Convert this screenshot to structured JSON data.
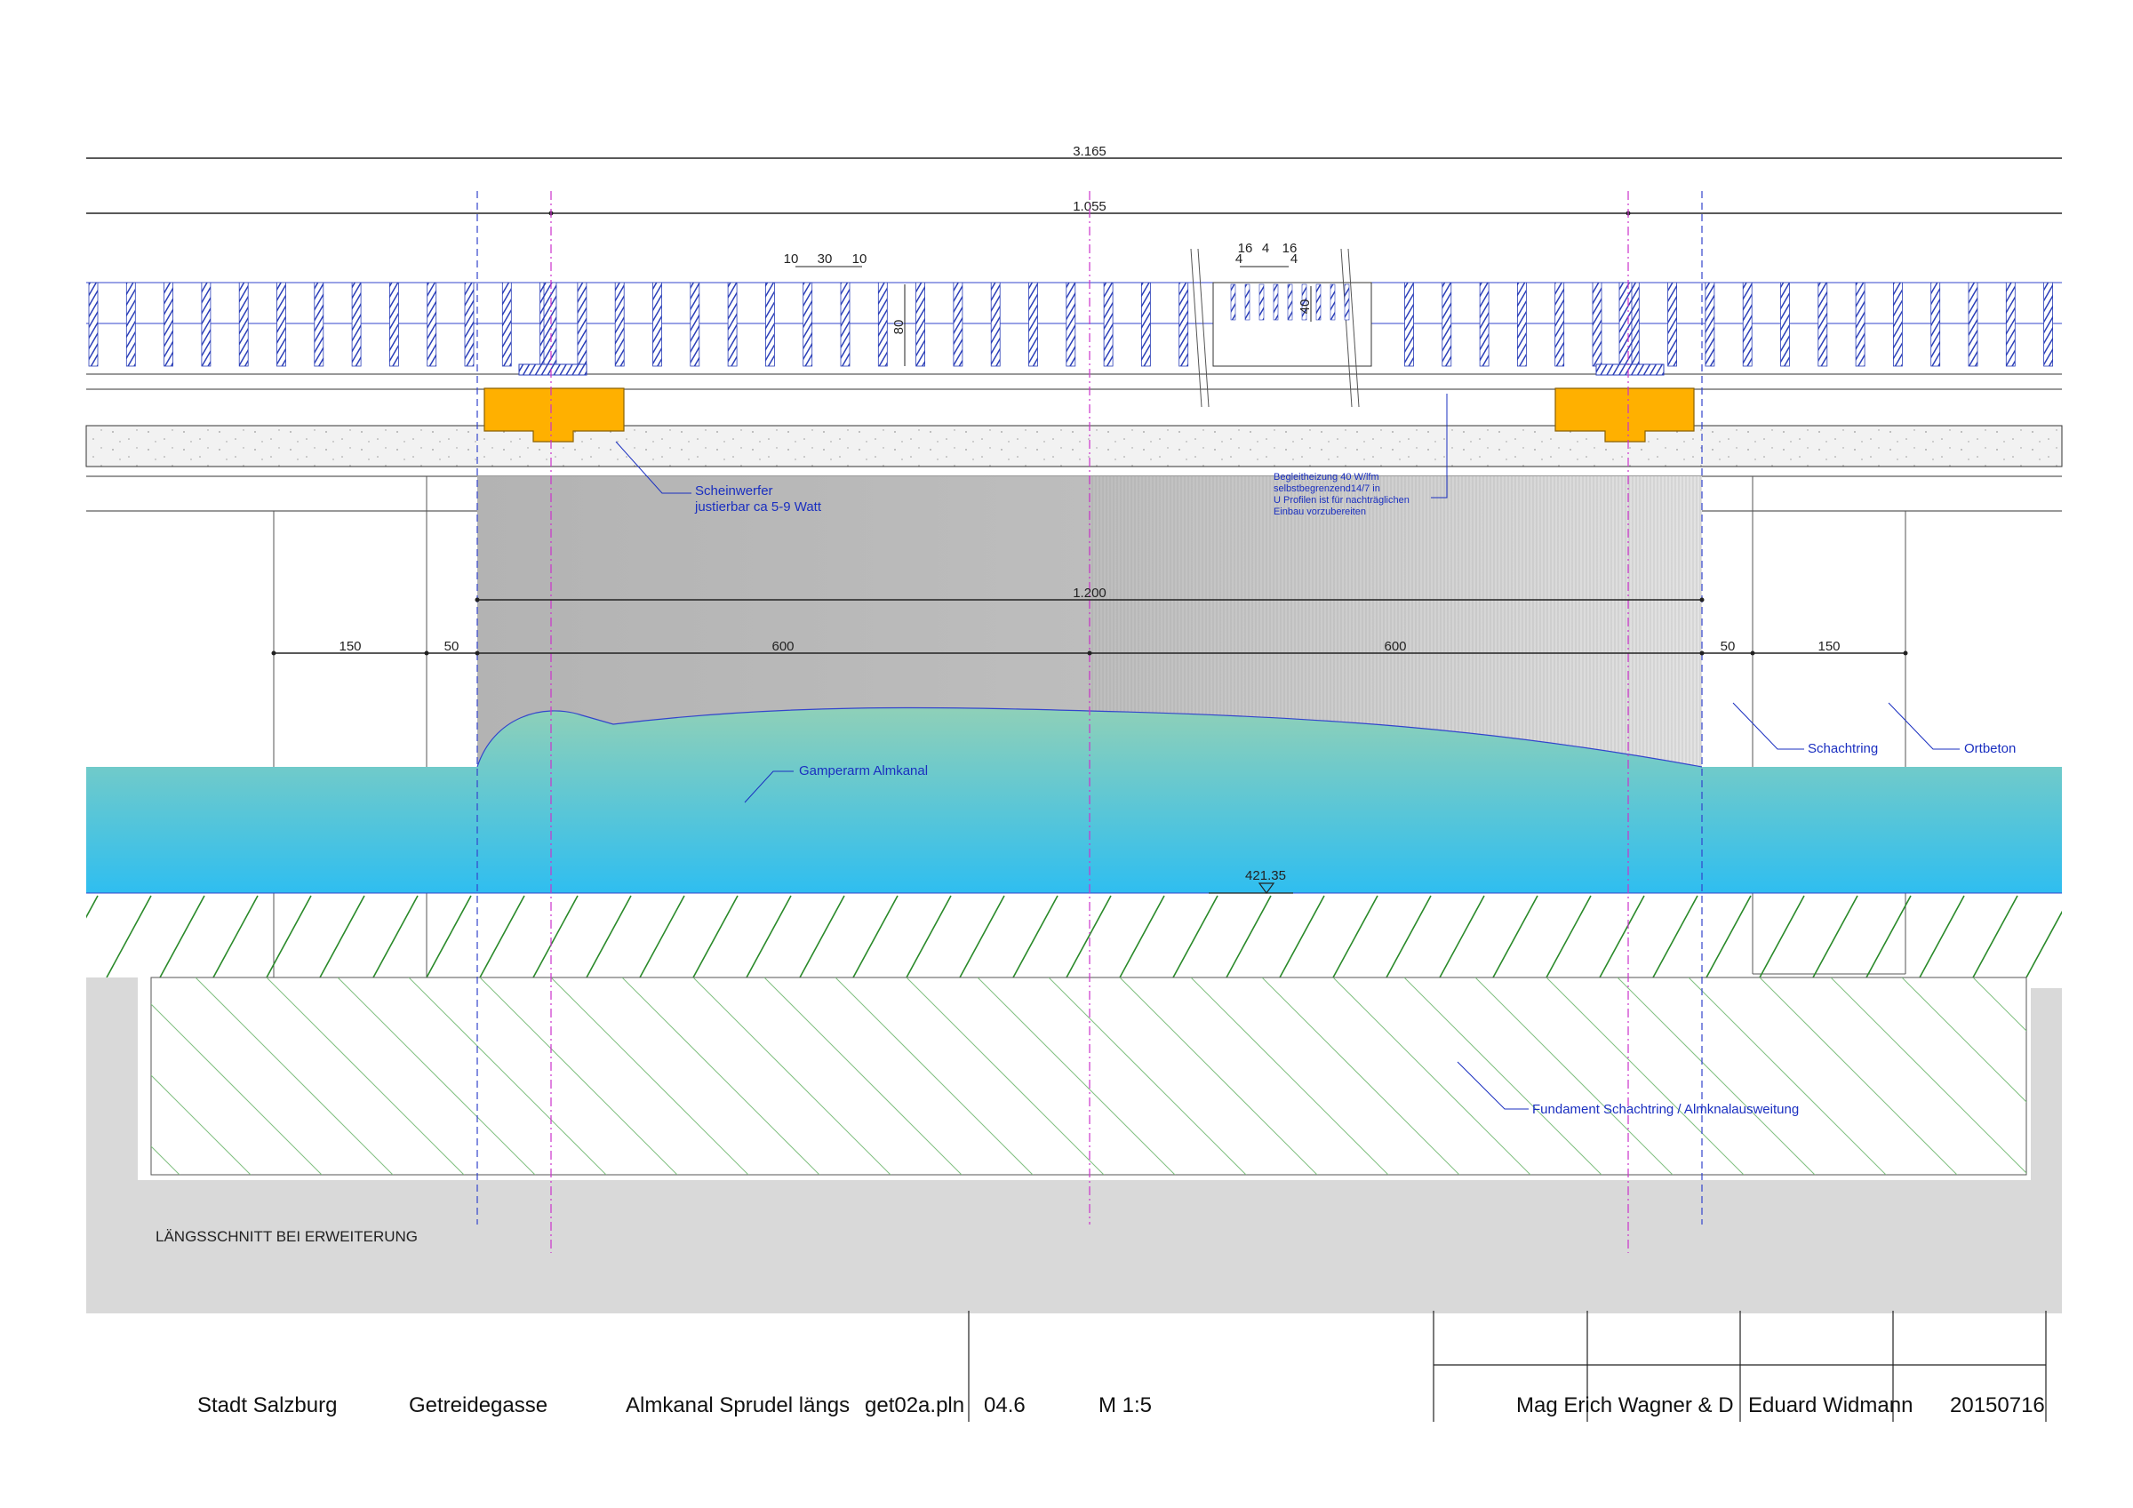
{
  "dimensions": {
    "total": "3.165",
    "span": "1.055",
    "grate_top_a": "10",
    "grate_top_b": "30",
    "grate_top_c": "10",
    "grate_slot_a": "16",
    "grate_slot_b": "4",
    "grate_slot_c": "16",
    "grate_slot_d": "4",
    "grate_slot_e": "4",
    "grate_height": "80",
    "grate_inner": "40",
    "basin_width": "1.200",
    "seg_left_outer": "150",
    "seg_left_inner": "50",
    "seg_mid_left": "600",
    "seg_mid_right": "600",
    "seg_right_inner": "50",
    "seg_right_outer": "150",
    "level": "421.35"
  },
  "annotations": {
    "scheinwerfer_line1": "Scheinwerfer",
    "scheinwerfer_line2": "justierbar ca 5-9 Watt",
    "heizung_line1": "Begleitheizung 40 W/lfm",
    "heizung_line2": "selbstbegrenzend14/7 in",
    "heizung_line3": "U Profilen ist für nachträglichen",
    "heizung_line4": "Einbau vorzubereiten",
    "gamperarm": "Gamperarm Almkanal",
    "schachtring": "Schachtring",
    "ortbeton": "Ortbeton",
    "fundament": "Fundament Schachtring / Almknalausweitung"
  },
  "section_title": "LÄNGSSCHNITT BEI ERWEITERUNG",
  "title_block": {
    "city": "Stadt Salzburg",
    "street": "Getreidegasse",
    "subject": "Almkanal Sprudel längs",
    "file": "get02a.pln",
    "sheet": "04.6",
    "scale": "M 1:5",
    "author1": "Mag Erich Wagner & D",
    "author2": "Eduard Widmann",
    "date": "20150716"
  },
  "colors": {
    "grate_hatch": "#2b3fb8",
    "lamp": "#ffb000",
    "water_top": "#8fd0b8",
    "water_bottom": "#2fbef0",
    "basin_fill": "#b8b8b8",
    "ground_hatch": "#2a8a2a",
    "guide_blue": "#3344cc",
    "guide_magenta": "#cc33cc",
    "annotation_blue": "#1a2fc0",
    "foundation_fill": "#d9d9d9"
  }
}
